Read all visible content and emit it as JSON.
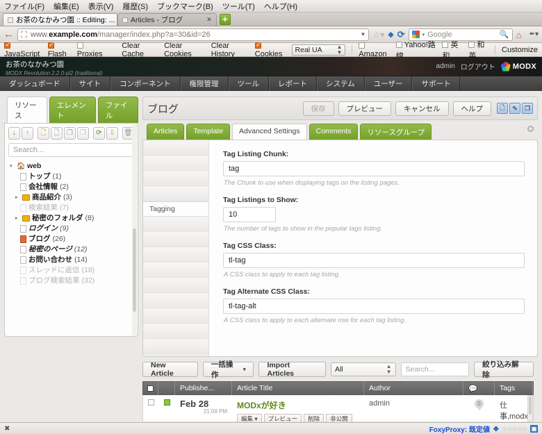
{
  "browser": {
    "menu": [
      "ファイル(F)",
      "編集(E)",
      "表示(V)",
      "履歴(S)",
      "ブックマーク(B)",
      "ツール(T)",
      "ヘルプ(H)"
    ],
    "tabs": [
      {
        "title": "お茶のなかみつ園 :: Editing: ...",
        "active": true,
        "close": "✖"
      },
      {
        "title": "Articles - ブログ",
        "active": false,
        "close": "✕"
      }
    ],
    "new_tab_label": "+",
    "back_arrow": "←",
    "url_domain_pre": "www.",
    "url_domain_bold": "example.com",
    "url_path": "/manager/index.php?a=30&id=26",
    "search_engine": "Google",
    "search_placeholder": "Google"
  },
  "addonbar": {
    "items": [
      {
        "label": "JavaScript",
        "checked": true
      },
      {
        "label": "Flash",
        "checked": true
      },
      {
        "label": "Proxies",
        "checked": false
      }
    ],
    "links": [
      "Clear Cache",
      "Clear Cookies",
      "Clear History"
    ],
    "cookies": {
      "label": "Cookies",
      "checked": true
    },
    "ua_select": "Real UA",
    "right_items": [
      {
        "label": "Amazon",
        "checked": false
      },
      {
        "label": "Yahoo!路線",
        "checked": false
      },
      {
        "label": "英和",
        "checked": false
      },
      {
        "label": "和英",
        "checked": false
      }
    ],
    "customize": "Customize"
  },
  "modx": {
    "site_name": "お茶のなかみつ園",
    "version": "MODX Revolution 2.2.0-pl2 (traditional)",
    "user": "admin",
    "logout": "ログアウト",
    "brand": "MODX",
    "nav": [
      "ダッシュボード",
      "サイト",
      "コンポーネント",
      "権限管理",
      "ツール",
      "レポート",
      "システム",
      "ユーザー",
      "サポート"
    ]
  },
  "tree": {
    "tabs": [
      {
        "label": "リソース",
        "active": true
      },
      {
        "label": "エレメント",
        "active": false
      },
      {
        "label": "ファイル",
        "active": false
      }
    ],
    "tools": [
      "↓",
      "↑",
      "新規ドキュメント",
      "新規シンボリックリンク",
      "複製",
      "貼り付け",
      "更新",
      "すべて折りたたむ",
      "削除"
    ],
    "search_placeholder": "Search...",
    "root": {
      "label": "web",
      "arrow": "▾"
    },
    "nodes": [
      {
        "label": "トップ",
        "count": "(1)",
        "type": "doc",
        "style": "bold",
        "dim": false,
        "arrow": ""
      },
      {
        "label": "会社情報",
        "count": "(2)",
        "type": "doc",
        "style": "bold",
        "dim": false,
        "arrow": ""
      },
      {
        "label": "商品紹介",
        "count": "(3)",
        "type": "folder",
        "style": "bold",
        "dim": false,
        "arrow": "▸"
      },
      {
        "label": "検索結果",
        "count": "(7)",
        "type": "doc",
        "style": "normal",
        "dim": true,
        "arrow": ""
      },
      {
        "label": "秘密のフォルダ",
        "count": "(8)",
        "type": "folder",
        "style": "bold",
        "dim": false,
        "arrow": "▸"
      },
      {
        "label": "ログイン",
        "count": "(9)",
        "type": "doc",
        "style": "bold-italic",
        "dim": false,
        "arrow": ""
      },
      {
        "label": "ブログ",
        "count": "(26)",
        "type": "current",
        "style": "bold",
        "dim": false,
        "arrow": ""
      },
      {
        "label": "秘密のページ",
        "count": "(12)",
        "type": "doc",
        "style": "bold-italic",
        "dim": false,
        "arrow": ""
      },
      {
        "label": "お問い合わせ",
        "count": "(14)",
        "type": "doc",
        "style": "bold",
        "dim": false,
        "arrow": ""
      },
      {
        "label": "スレッドに返信",
        "count": "(18)",
        "type": "doc",
        "style": "normal",
        "dim": true,
        "arrow": ""
      },
      {
        "label": "ブログ検索結果",
        "count": "(32)",
        "type": "doc",
        "style": "normal",
        "dim": true,
        "arrow": ""
      }
    ]
  },
  "main": {
    "title": "ブログ",
    "buttons": [
      {
        "label": "保存",
        "disabled": true
      },
      {
        "label": "プレビュー",
        "disabled": false
      },
      {
        "label": "キャンセル",
        "disabled": false
      },
      {
        "label": "ヘルプ",
        "disabled": false
      }
    ],
    "icon_buttons": [
      "新規リソース",
      "編集",
      "複製"
    ],
    "tabs": [
      {
        "label": "Articles",
        "active": false
      },
      {
        "label": "Template",
        "active": false
      },
      {
        "label": "Advanced Settings",
        "active": true
      },
      {
        "label": "Comments",
        "active": false
      },
      {
        "label": "リソースグループ",
        "active": false
      }
    ],
    "vtab_active": "Tagging",
    "fields": [
      {
        "label": "Tag Listing Chunk:",
        "value": "tag",
        "hint": "The Chunk to use when displaying tags on the listing pages.",
        "short": false
      },
      {
        "label": "Tag Listings to Show:",
        "value": "10",
        "hint": "The number of tags to show in the popular tags listing.",
        "short": true
      },
      {
        "label": "Tag CSS Class:",
        "value": "tl-tag",
        "hint": "A CSS class to apply to each tag listing.",
        "short": false
      },
      {
        "label": "Tag Alternate CSS Class:",
        "value": "tl-tag-alt",
        "hint": "A CSS class to apply to each alternate row for each tag listing.",
        "short": false
      }
    ]
  },
  "grid": {
    "toolbar": {
      "new_article": "New Article",
      "bulk_actions": "一括操作",
      "bulk_caret": "▾",
      "import_articles": "Import Articles",
      "filter_value": "All",
      "search_placeholder": "Search...",
      "clear_filter": "絞り込み解除"
    },
    "columns": [
      "Publishe...",
      "Article Title",
      "Author",
      "💬",
      "Tags"
    ],
    "rows": [
      {
        "date": "Feb 28",
        "time": "21:09 PM",
        "title": "MODxが好き",
        "author": "admin",
        "comments": "0",
        "tags": "仕事,modx",
        "actions": [
          "編集 ▾",
          "プレビュー",
          "削除",
          "非公開"
        ]
      }
    ]
  },
  "statusbar": {
    "left_icon": "✖",
    "foxyproxy": "FoxyProxy: 既定値",
    "stars": "☆☆☆☆☆",
    "badge": "▣"
  }
}
